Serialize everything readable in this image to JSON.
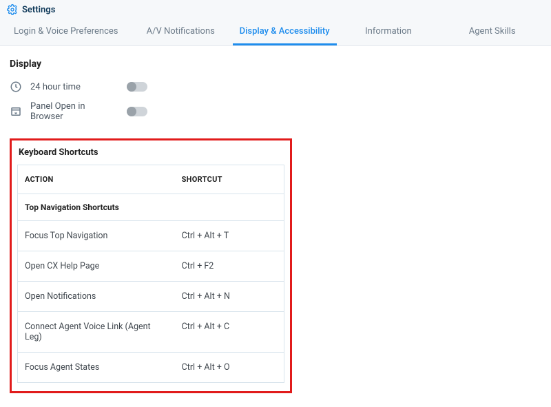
{
  "header": {
    "title": "Settings"
  },
  "tabs": [
    {
      "label": "Login & Voice Preferences",
      "active": false
    },
    {
      "label": "A/V Notifications",
      "active": false
    },
    {
      "label": "Display & Accessibility",
      "active": true
    },
    {
      "label": "Information",
      "active": false
    },
    {
      "label": "Agent Skills",
      "active": false
    }
  ],
  "display_section": {
    "title": "Display",
    "rows": [
      {
        "icon": "clock-icon",
        "label": "24 hour time",
        "toggled": false
      },
      {
        "icon": "panel-icon",
        "label": "Panel Open in Browser",
        "toggled": false
      }
    ]
  },
  "keyboard_shortcuts": {
    "title": "Keyboard Shortcuts",
    "columns": {
      "action": "ACTION",
      "shortcut": "SHORTCUT"
    },
    "subheading": "Top Navigation Shortcuts",
    "rows": [
      {
        "action": "Focus Top Navigation",
        "shortcut": "Ctrl + Alt + T"
      },
      {
        "action": "Open CX Help Page",
        "shortcut": "Ctrl + F2"
      },
      {
        "action": "Open Notifications",
        "shortcut": "Ctrl + Alt + N"
      },
      {
        "action": "Connect Agent Voice Link (Agent Leg)",
        "shortcut": "Ctrl + Alt + C"
      },
      {
        "action": "Focus Agent States",
        "shortcut": "Ctrl + Alt + O"
      }
    ]
  }
}
